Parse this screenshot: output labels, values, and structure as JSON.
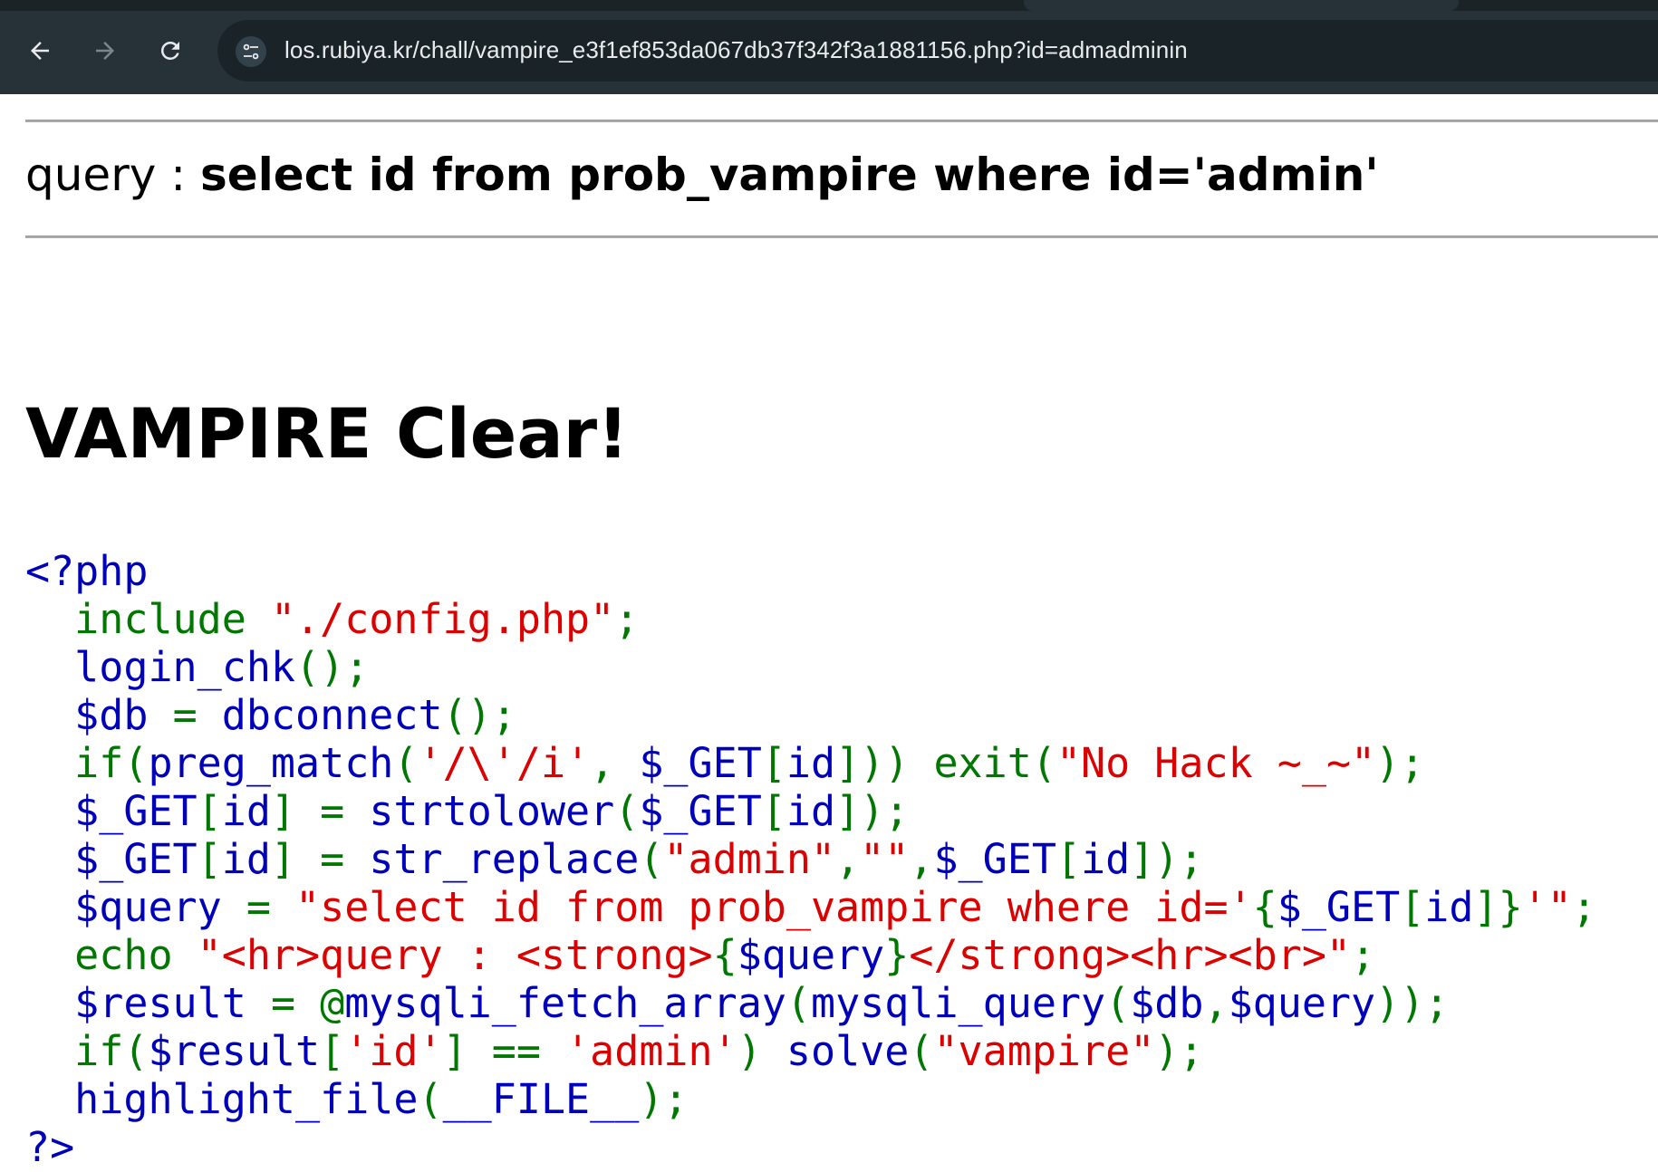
{
  "browser": {
    "url": "los.rubiya.kr/chall/vampire_e3f1ef853da067db37f342f3a1881156.php?id=admadminin",
    "icons": {
      "back": "back-arrow-icon",
      "forward": "forward-arrow-icon",
      "reload": "reload-icon",
      "site_settings": "site-settings-icon"
    }
  },
  "page": {
    "query_label": "query : ",
    "query_value": "select id from prob_vampire where id='admin'",
    "heading": "VAMPIRE Clear!"
  },
  "source_code": {
    "colors": {
      "default": "#0000bb",
      "keyword": "#007700",
      "string": "#dd0000"
    },
    "lines": [
      [
        {
          "t": "<?php",
          "c": "blue"
        }
      ],
      [
        {
          "t": "  include ",
          "c": "green"
        },
        {
          "t": "\"./config.php\"",
          "c": "red"
        },
        {
          "t": ";",
          "c": "green"
        }
      ],
      [
        {
          "t": "  login_chk",
          "c": "blue"
        },
        {
          "t": "();",
          "c": "green"
        }
      ],
      [
        {
          "t": "  $db ",
          "c": "blue"
        },
        {
          "t": "= ",
          "c": "green"
        },
        {
          "t": "dbconnect",
          "c": "blue"
        },
        {
          "t": "();",
          "c": "green"
        }
      ],
      [
        {
          "t": "  if(",
          "c": "green"
        },
        {
          "t": "preg_match",
          "c": "blue"
        },
        {
          "t": "(",
          "c": "green"
        },
        {
          "t": "'/\\'/i'",
          "c": "red"
        },
        {
          "t": ", ",
          "c": "green"
        },
        {
          "t": "$_GET",
          "c": "blue"
        },
        {
          "t": "[",
          "c": "green"
        },
        {
          "t": "id",
          "c": "blue"
        },
        {
          "t": "])) exit(",
          "c": "green"
        },
        {
          "t": "\"No Hack ~_~\"",
          "c": "red"
        },
        {
          "t": ");",
          "c": "green"
        }
      ],
      [
        {
          "t": "  $_GET",
          "c": "blue"
        },
        {
          "t": "[",
          "c": "green"
        },
        {
          "t": "id",
          "c": "blue"
        },
        {
          "t": "] = ",
          "c": "green"
        },
        {
          "t": "strtolower",
          "c": "blue"
        },
        {
          "t": "(",
          "c": "green"
        },
        {
          "t": "$_GET",
          "c": "blue"
        },
        {
          "t": "[",
          "c": "green"
        },
        {
          "t": "id",
          "c": "blue"
        },
        {
          "t": "]);",
          "c": "green"
        }
      ],
      [
        {
          "t": "  $_GET",
          "c": "blue"
        },
        {
          "t": "[",
          "c": "green"
        },
        {
          "t": "id",
          "c": "blue"
        },
        {
          "t": "] = ",
          "c": "green"
        },
        {
          "t": "str_replace",
          "c": "blue"
        },
        {
          "t": "(",
          "c": "green"
        },
        {
          "t": "\"admin\"",
          "c": "red"
        },
        {
          "t": ",",
          "c": "green"
        },
        {
          "t": "\"\"",
          "c": "red"
        },
        {
          "t": ",",
          "c": "green"
        },
        {
          "t": "$_GET",
          "c": "blue"
        },
        {
          "t": "[",
          "c": "green"
        },
        {
          "t": "id",
          "c": "blue"
        },
        {
          "t": "]);",
          "c": "green"
        }
      ],
      [
        {
          "t": "  $query ",
          "c": "blue"
        },
        {
          "t": "= ",
          "c": "green"
        },
        {
          "t": "\"select id from prob_vampire where id='",
          "c": "red"
        },
        {
          "t": "{",
          "c": "green"
        },
        {
          "t": "$_GET",
          "c": "blue"
        },
        {
          "t": "[",
          "c": "green"
        },
        {
          "t": "id",
          "c": "blue"
        },
        {
          "t": "]}",
          "c": "green"
        },
        {
          "t": "'\"",
          "c": "red"
        },
        {
          "t": ";",
          "c": "green"
        }
      ],
      [
        {
          "t": "  echo ",
          "c": "green"
        },
        {
          "t": "\"<hr>query : <strong>",
          "c": "red"
        },
        {
          "t": "{",
          "c": "green"
        },
        {
          "t": "$query",
          "c": "blue"
        },
        {
          "t": "}",
          "c": "green"
        },
        {
          "t": "</strong><hr><br>\"",
          "c": "red"
        },
        {
          "t": ";",
          "c": "green"
        }
      ],
      [
        {
          "t": "  $result ",
          "c": "blue"
        },
        {
          "t": "= @",
          "c": "green"
        },
        {
          "t": "mysqli_fetch_array",
          "c": "blue"
        },
        {
          "t": "(",
          "c": "green"
        },
        {
          "t": "mysqli_query",
          "c": "blue"
        },
        {
          "t": "(",
          "c": "green"
        },
        {
          "t": "$db",
          "c": "blue"
        },
        {
          "t": ",",
          "c": "green"
        },
        {
          "t": "$query",
          "c": "blue"
        },
        {
          "t": "));",
          "c": "green"
        }
      ],
      [
        {
          "t": "  if(",
          "c": "green"
        },
        {
          "t": "$result",
          "c": "blue"
        },
        {
          "t": "[",
          "c": "green"
        },
        {
          "t": "'id'",
          "c": "red"
        },
        {
          "t": "] == ",
          "c": "green"
        },
        {
          "t": "'admin'",
          "c": "red"
        },
        {
          "t": ") ",
          "c": "green"
        },
        {
          "t": "solve",
          "c": "blue"
        },
        {
          "t": "(",
          "c": "green"
        },
        {
          "t": "\"vampire\"",
          "c": "red"
        },
        {
          "t": ");",
          "c": "green"
        }
      ],
      [
        {
          "t": "  highlight_file",
          "c": "blue"
        },
        {
          "t": "(",
          "c": "green"
        },
        {
          "t": "__FILE__",
          "c": "blue"
        },
        {
          "t": ");",
          "c": "green"
        }
      ],
      [
        {
          "t": "?>",
          "c": "blue"
        }
      ]
    ]
  }
}
